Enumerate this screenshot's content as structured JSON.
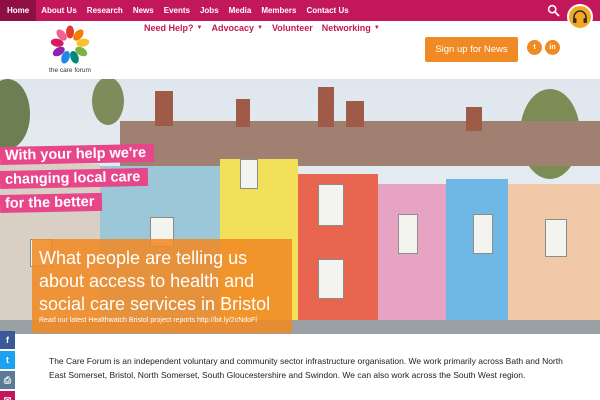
{
  "topnav": {
    "items": [
      {
        "label": "Home",
        "active": true
      },
      {
        "label": "About Us"
      },
      {
        "label": "Research"
      },
      {
        "label": "News"
      },
      {
        "label": "Events"
      },
      {
        "label": "Jobs"
      },
      {
        "label": "Media"
      },
      {
        "label": "Members"
      },
      {
        "label": "Contact Us"
      }
    ],
    "search_icon": "search-icon",
    "avatar_icon": "headphones-avatar-icon"
  },
  "header": {
    "logo_text": "the care forum",
    "subnav": [
      {
        "label": "Need Help?",
        "dropdown": true
      },
      {
        "label": "Advocacy",
        "dropdown": true
      },
      {
        "label": "Volunteer",
        "dropdown": false
      },
      {
        "label": "Networking",
        "dropdown": true
      }
    ],
    "signup_label": "Sign up for News",
    "social": [
      {
        "icon": "twitter-icon",
        "glyph": "t"
      },
      {
        "icon": "linkedin-icon",
        "glyph": "in"
      }
    ]
  },
  "hero": {
    "banner_lines": [
      "With your help we're",
      "changing local care",
      "for the better"
    ],
    "caption_title": "What people are telling us about access to health and social care services in Bristol",
    "caption_sub": "Read our latest Healthwatch Bristol project reports http://bit.ly/2cNdoFl"
  },
  "share_bar": [
    {
      "icon": "facebook-icon",
      "glyph": "f",
      "color": "#3b5998"
    },
    {
      "icon": "twitter-icon",
      "glyph": "t",
      "color": "#1da1f2"
    },
    {
      "icon": "print-icon",
      "glyph": "⎙",
      "color": "#5b7a96"
    },
    {
      "icon": "email-icon",
      "glyph": "✉",
      "color": "#c2185b"
    }
  ],
  "intro": {
    "text": "The Care Forum is an independent voluntary and community sector infrastructure organisation. We work primarily across Bath and North East Somerset, Bristol, North Somerset, South Gloucestershire and Swindon. We can also work across the South West region."
  },
  "colors": {
    "brand_pink": "#c2185b",
    "accent_orange": "#f08a24",
    "banner_pink": "#e8468a"
  }
}
